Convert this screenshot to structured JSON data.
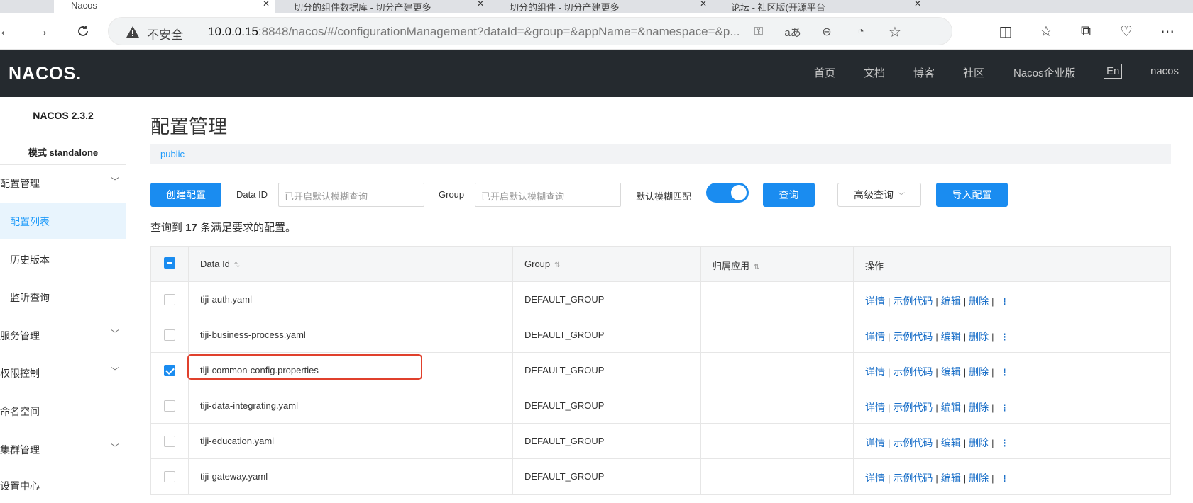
{
  "browser": {
    "tabs": [
      {
        "label": "Nacos",
        "active": true
      },
      {
        "label": "切分的组件数据库 - 切分产建更多",
        "active": false
      },
      {
        "label": "切分的组件 - 切分产建更多",
        "active": false
      },
      {
        "label": "论坛 - 社区版(开源平台",
        "active": false
      }
    ],
    "insecure_label": "不安全",
    "url_host": "10.0.0.15",
    "url_rest": ":8848/nacos/#/configurationManagement?dataId=&group=&appName=&namespace=&p..."
  },
  "header": {
    "logo": "NACOS.",
    "nav": [
      "首页",
      "文档",
      "博客",
      "社区",
      "Nacos企业版",
      "En",
      "nacos"
    ]
  },
  "sidebar": {
    "version": "NACOS 2.3.2",
    "mode": "模式 standalone",
    "items": [
      {
        "label": "配置管理",
        "expandable": true
      },
      {
        "label": "配置列表",
        "active": true
      },
      {
        "label": "历史版本"
      },
      {
        "label": "监听查询"
      },
      {
        "label": "服务管理",
        "expandable": true
      },
      {
        "label": "权限控制",
        "expandable": true
      },
      {
        "label": "命名空间"
      },
      {
        "label": "集群管理",
        "expandable": true
      },
      {
        "label": "设置中心"
      }
    ]
  },
  "main": {
    "title": "配置管理",
    "namespace": "public",
    "toolbar": {
      "create_label": "创建配置",
      "dataid_label": "Data ID",
      "dataid_placeholder": "已开启默认模糊查询",
      "group_label": "Group",
      "group_placeholder": "已开启默认模糊查询",
      "fuzzy_label": "默认模糊匹配",
      "fuzzy_enabled": true,
      "query_label": "查询",
      "advanced_label": "高级查询",
      "import_label": "导入配置"
    },
    "result_prefix": "查询到",
    "result_count": "17",
    "result_suffix": "条满足要求的配置。",
    "table": {
      "headers": [
        "Data Id",
        "Group",
        "归属应用",
        "操作"
      ],
      "actions": [
        "详情",
        "示例代码",
        "编辑",
        "删除"
      ],
      "rows": [
        {
          "data_id": "tiji-auth.yaml",
          "group": "DEFAULT_GROUP",
          "app": "",
          "checked": false
        },
        {
          "data_id": "tiji-business-process.yaml",
          "group": "DEFAULT_GROUP",
          "app": "",
          "checked": false
        },
        {
          "data_id": "tiji-common-config.properties",
          "group": "DEFAULT_GROUP",
          "app": "",
          "checked": true
        },
        {
          "data_id": "tiji-data-integrating.yaml",
          "group": "DEFAULT_GROUP",
          "app": "",
          "checked": false
        },
        {
          "data_id": "tiji-education.yaml",
          "group": "DEFAULT_GROUP",
          "app": "",
          "checked": false
        },
        {
          "data_id": "tiji-gateway.yaml",
          "group": "DEFAULT_GROUP",
          "app": "",
          "checked": false
        }
      ]
    }
  },
  "colors": {
    "primary": "#1a8cf0",
    "header_bg": "#252a2f",
    "highlight": "#e0402c"
  }
}
